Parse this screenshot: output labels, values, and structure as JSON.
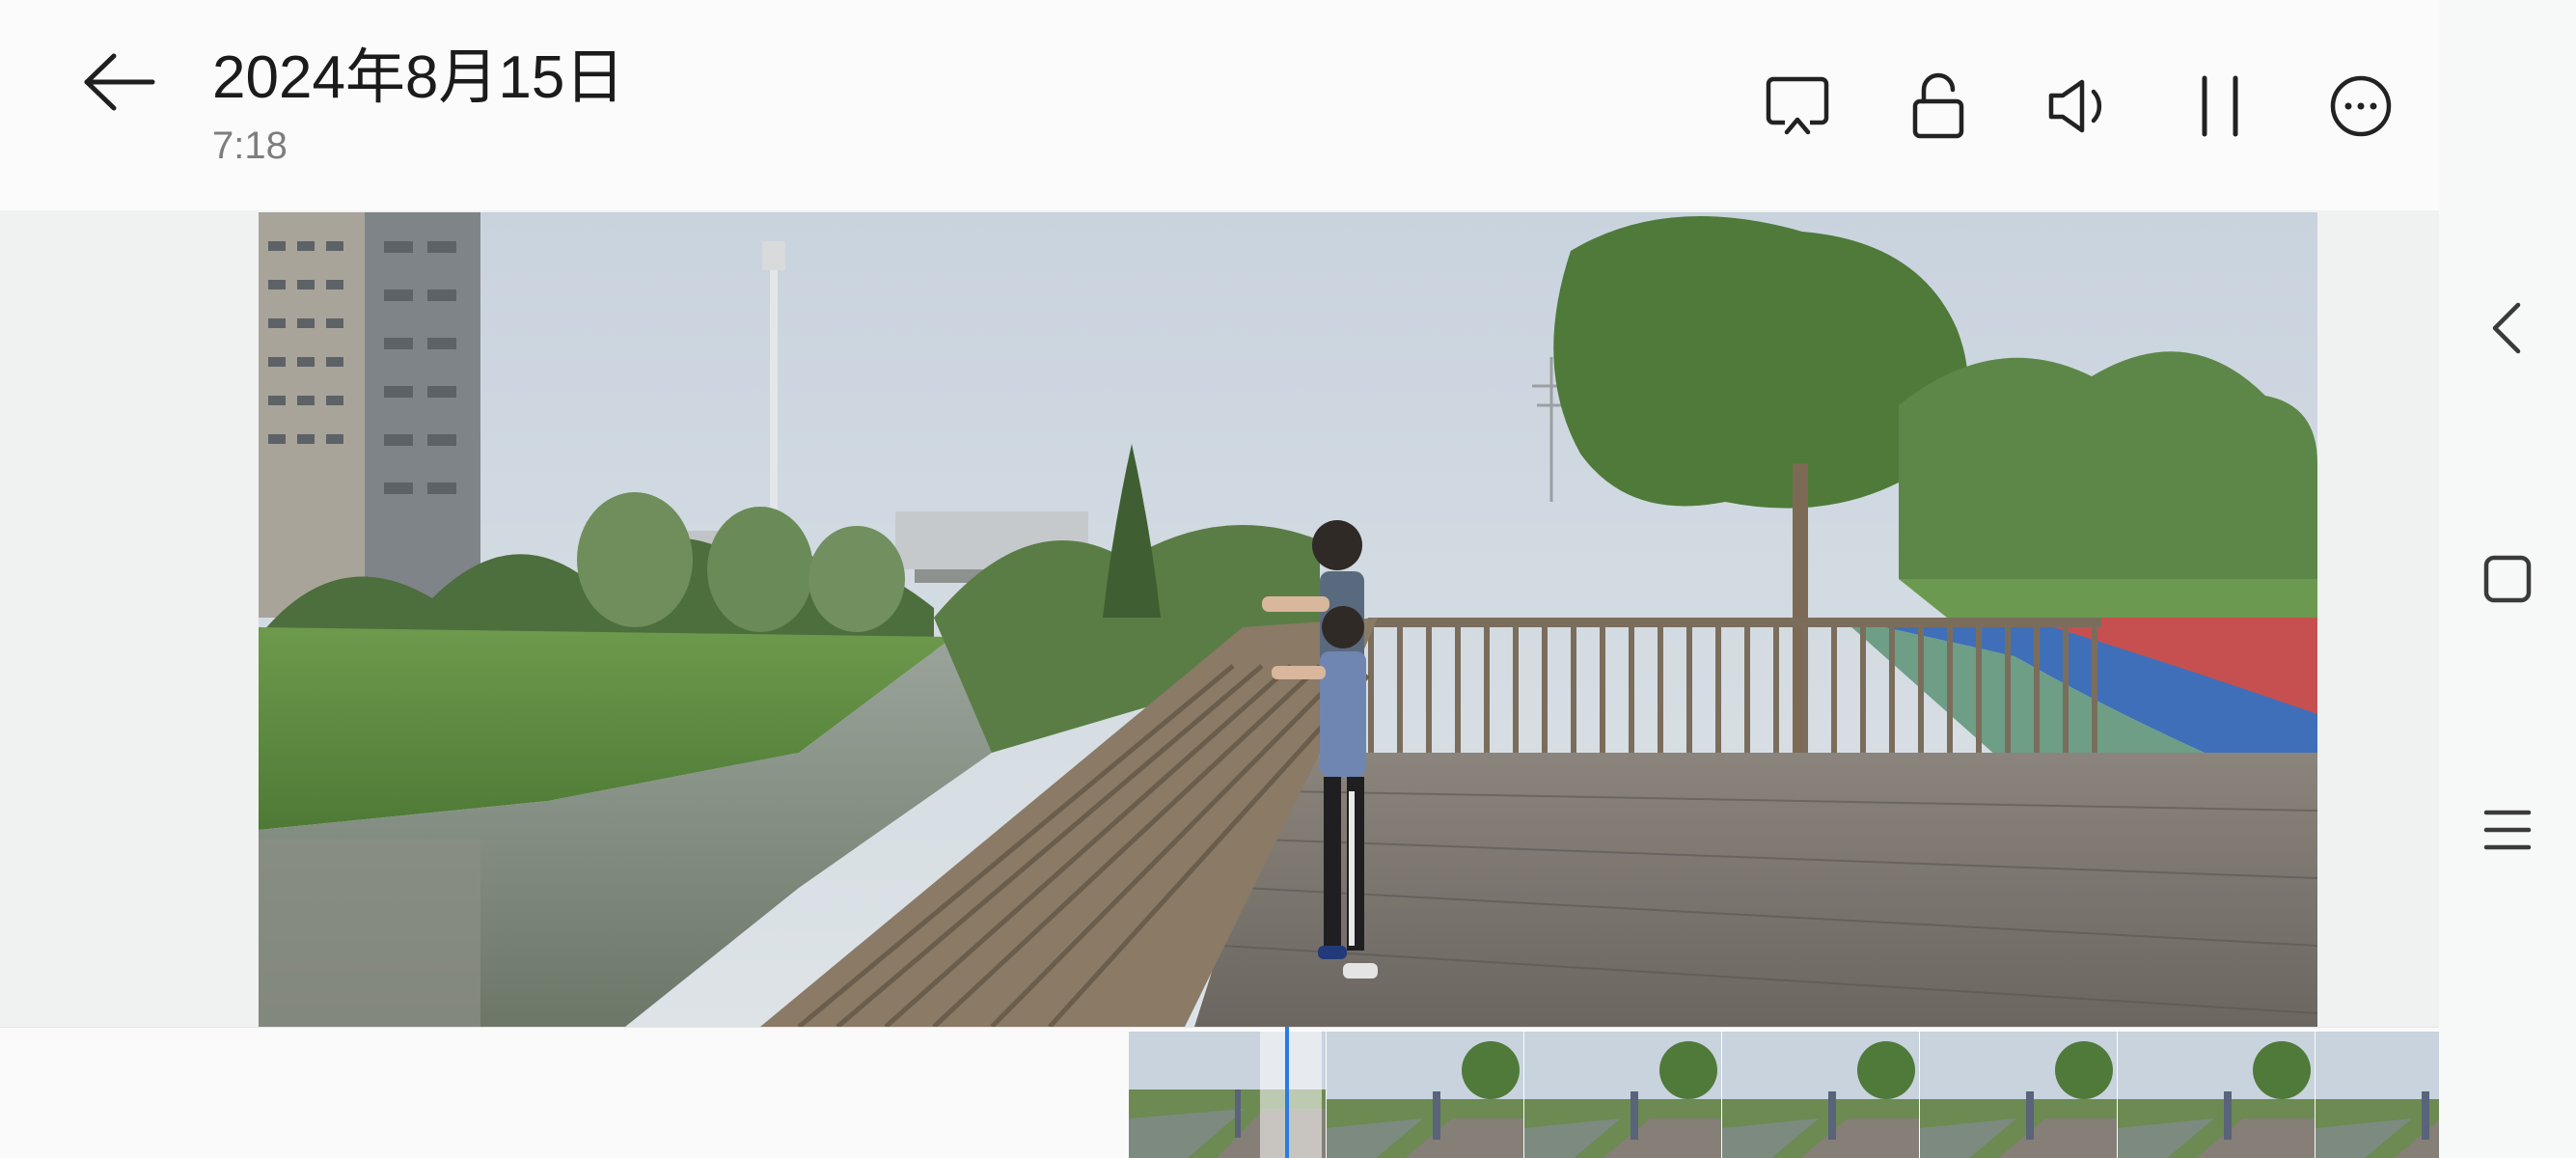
{
  "header": {
    "date_title": "2024年8月15日",
    "time_subtitle": "7:18"
  },
  "toolbar": {
    "items": [
      {
        "name": "cast-icon"
      },
      {
        "name": "unlock-icon"
      },
      {
        "name": "volume-icon"
      },
      {
        "name": "pause-icon"
      },
      {
        "name": "more-icon"
      }
    ]
  },
  "nav": {
    "items": [
      {
        "name": "nav-back-icon"
      },
      {
        "name": "nav-home-icon"
      },
      {
        "name": "nav-menu-icon"
      }
    ]
  },
  "colors": {
    "accent": "#2a7be4",
    "text_primary": "#1b1b1b",
    "text_secondary": "#7d7d7d"
  }
}
